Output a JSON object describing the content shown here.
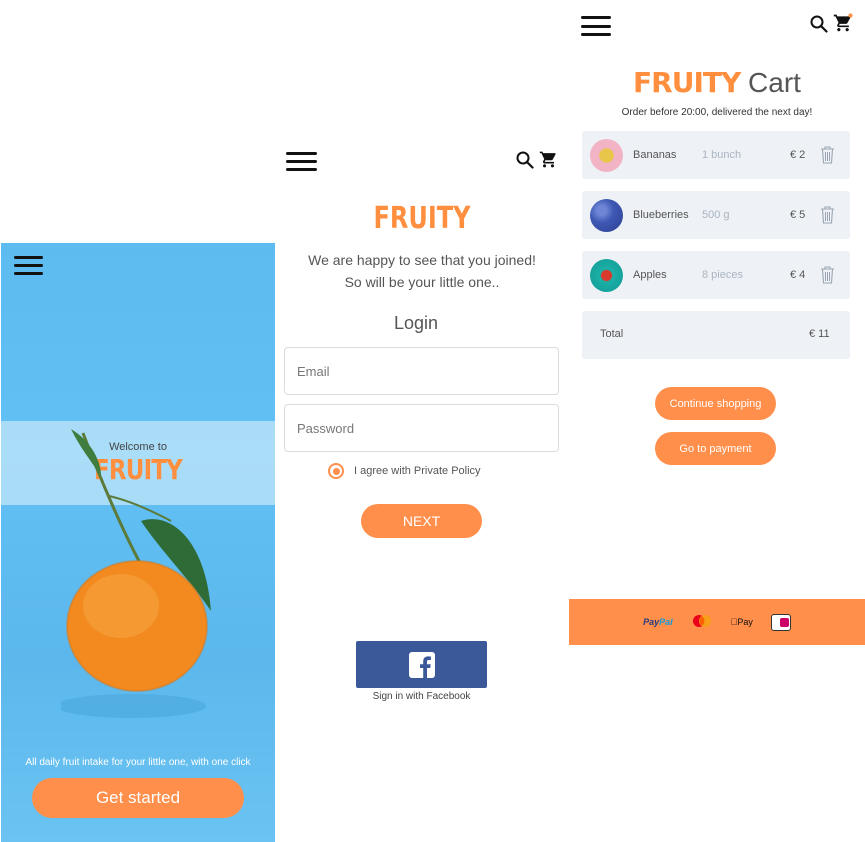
{
  "welcome_screen": {
    "welcome_text": "Welcome to",
    "brand": "FRUITY",
    "tagline": "All daily fruit intake for your little one, with one click",
    "cta_label": "Get started"
  },
  "login_screen": {
    "brand": "FRUITY",
    "lead_line1": "We are happy to see that you joined!",
    "lead_line2": "So will be your little one..",
    "heading": "Login",
    "email_placeholder": "Email",
    "password_placeholder": "Password",
    "agree_label": "I agree with Private Policy",
    "next_label": "NEXT",
    "facebook_label": "Sign in with Facebook"
  },
  "cart_screen": {
    "title_brand": "FRUITY",
    "title_rest": "Cart",
    "subtitle": "Order before 20:00, delivered the next day!",
    "items": [
      {
        "name": "Bananas",
        "qty": "1 bunch",
        "price": "€ 2"
      },
      {
        "name": "Blueberries",
        "qty": "500 g",
        "price": "€ 5"
      },
      {
        "name": "Apples",
        "qty": "8 pieces",
        "price": "€ 4"
      }
    ],
    "total_label": "Total",
    "total_value": "€ 11",
    "continue_label": "Continue shopping",
    "payment_label": "Go to payment",
    "payment_methods": {
      "paypal_dark": "Pay",
      "paypal_light": "Pal",
      "applepay": "Pay"
    }
  },
  "colors": {
    "accent": "#ff8f4a",
    "sky": "#62c0f4",
    "facebook": "#3b5998",
    "row_bg": "#eef2f6"
  },
  "icons": [
    "menu-icon",
    "search-icon",
    "cart-icon",
    "trash-icon",
    "facebook-icon",
    "radio-icon",
    "paypal-icon",
    "mastercard-icon",
    "applepay-icon",
    "ideal-icon"
  ]
}
